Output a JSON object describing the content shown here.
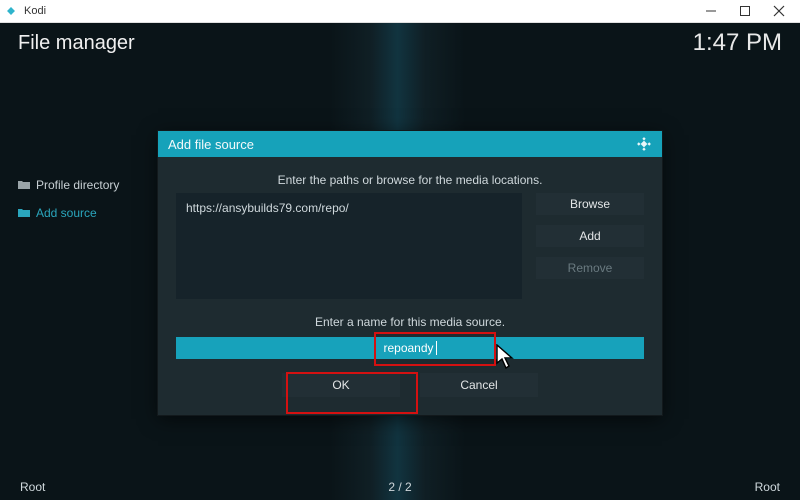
{
  "window": {
    "app_name": "Kodi"
  },
  "header": {
    "title": "File manager",
    "clock": "1:47 PM"
  },
  "sidebar": {
    "items": [
      {
        "label": "Profile directory"
      },
      {
        "label": "Add source"
      }
    ]
  },
  "footer": {
    "left": "Root",
    "mid": "2 / 2",
    "right": "Root"
  },
  "dialog": {
    "title": "Add file source",
    "instr_paths": "Enter the paths or browse for the media locations.",
    "path_value": "https://ansybuilds79.com/repo/",
    "btn_browse": "Browse",
    "btn_add": "Add",
    "btn_remove": "Remove",
    "instr_name": "Enter a name for this media source.",
    "name_value": "repoandy",
    "btn_ok": "OK",
    "btn_cancel": "Cancel"
  },
  "colors": {
    "accent": "#16a2ba"
  }
}
